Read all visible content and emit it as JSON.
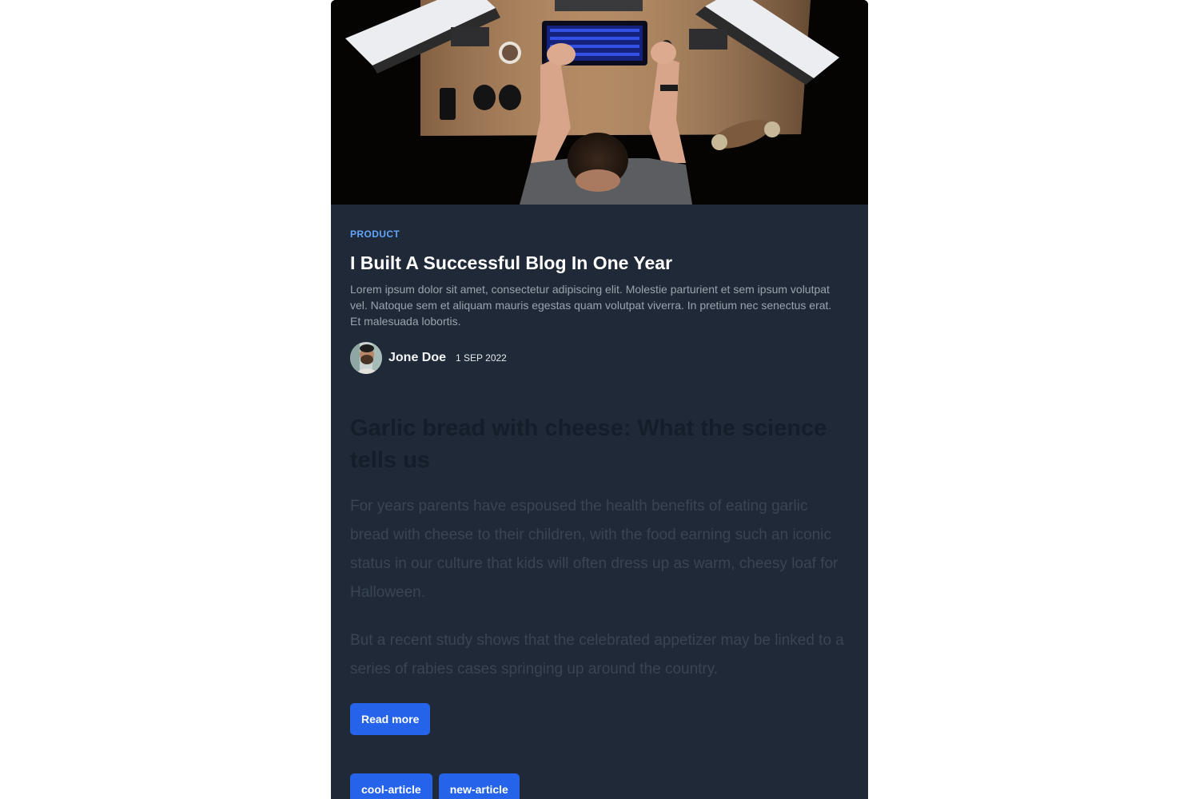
{
  "post": {
    "category": "PRODUCT",
    "title": "I Built A Successful Blog In One Year",
    "excerpt": "Lorem ipsum dolor sit amet, consectetur adipiscing elit. Molestie parturient et sem ipsum volutpat vel. Natoque sem et aliquam mauris egestas quam volutpat viverra. In pretium nec senectus erat. Et malesuada lobortis.",
    "author": "Jone Doe",
    "date": "1 SEP 2022"
  },
  "article": {
    "heading": "Garlic bread with cheese: What the science tells us",
    "paragraphs": [
      "For years parents have espoused the health benefits of eating garlic bread with cheese to their children, with the food earning such an iconic status in our culture that kids will often dress up as warm, cheesy loaf for Halloween.",
      "But a recent study shows that the celebrated appetizer may be linked to a series of rabies cases springing up around the country."
    ]
  },
  "actions": {
    "read_more_label": "Read more"
  },
  "tags": [
    "cool-article",
    "new-article"
  ],
  "colors": {
    "card_background": "#1f2937",
    "accent": "#2563eb",
    "category": "#60a5fa"
  }
}
